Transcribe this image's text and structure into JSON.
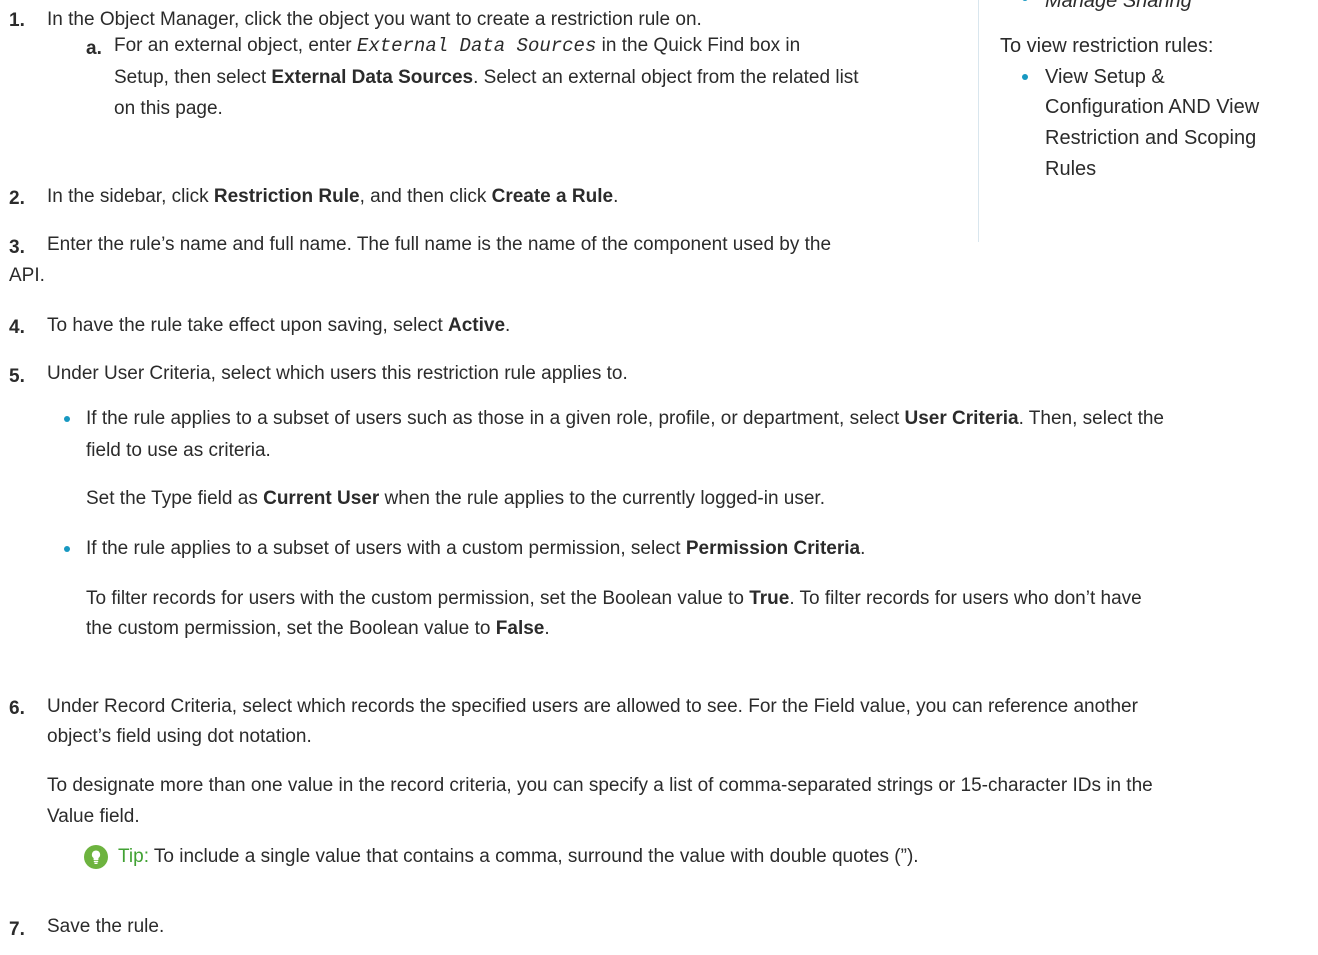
{
  "steps": [
    {
      "num": "1.",
      "text": "In the Object Manager, click the object you want to create a restriction rule on."
    },
    {
      "num": "2.",
      "pre": "In the sidebar, click ",
      "b1": "Restriction Rule",
      "mid": ", and then click ",
      "b2": "Create a Rule",
      "post": "."
    },
    {
      "num": "3.",
      "line1": "Enter the rule’s name and full name. The full name is the name of the component used by the",
      "line2": "API."
    },
    {
      "num": "4.",
      "pre": "To have the rule take effect upon saving, select ",
      "b1": "Active",
      "post": "."
    },
    {
      "num": "5.",
      "text": "Under User Criteria, select which users this restriction rule applies to."
    },
    {
      "num": "6.",
      "line1": "Under Record Criteria, select which records the specified users are allowed to see. For the Field value, you can reference another",
      "line2": "object’s field using dot notation.",
      "para_line1": "To designate more than one value in the record criteria, you can specify a list of comma-separated strings or 15-character IDs in the",
      "para_line2": "Value field."
    },
    {
      "num": "7.",
      "text": "Save the rule."
    }
  ],
  "substep_a": {
    "letter": "a.",
    "pre": "For an external object, enter ",
    "code": "External Data Sources",
    "mid": " in the Quick Find box in",
    "line2_pre": "Setup, then select ",
    "line2_b": "External Data Sources",
    "line2_post": ". Select an external object from the related list",
    "line3": "on this page."
  },
  "bullets": {
    "user": {
      "pre": "If the rule applies to a subset of users such as those in a given role, profile, or department, select ",
      "b": "User Criteria",
      "post": ". Then, select the",
      "line2": "field to use as criteria.",
      "para_pre": "Set the Type field as ",
      "para_b": "Current User",
      "para_post": " when the rule applies to the currently logged-in user."
    },
    "perm": {
      "pre": "If the rule applies to a subset of users with a custom permission, select ",
      "b": "Permission Criteria",
      "post": ".",
      "p1_pre": "To filter records for users with the custom permission, set the Boolean value to ",
      "p1_b": "True",
      "p1_post": ". To filter records for users who don’t have",
      "p2_pre": "the custom permission, set the Boolean value to ",
      "p2_b": "False",
      "p2_post": "."
    }
  },
  "tip": {
    "label": "Tip:",
    "text": " To include a single value that contains a comma, surround the value with double quotes (”).",
    "icon": "lightbulb-icon"
  },
  "sidebar": {
    "partial_item": "Manage Sharing",
    "heading": "To view restriction rules:",
    "item_lines": [
      "View Setup &",
      "Configuration AND View",
      "Restriction and Scoping",
      "Rules"
    ]
  },
  "colors": {
    "bullet": "#1798c1",
    "tip": "#41a133",
    "tip_icon": "#6db33f",
    "text": "#2b2b2b"
  }
}
